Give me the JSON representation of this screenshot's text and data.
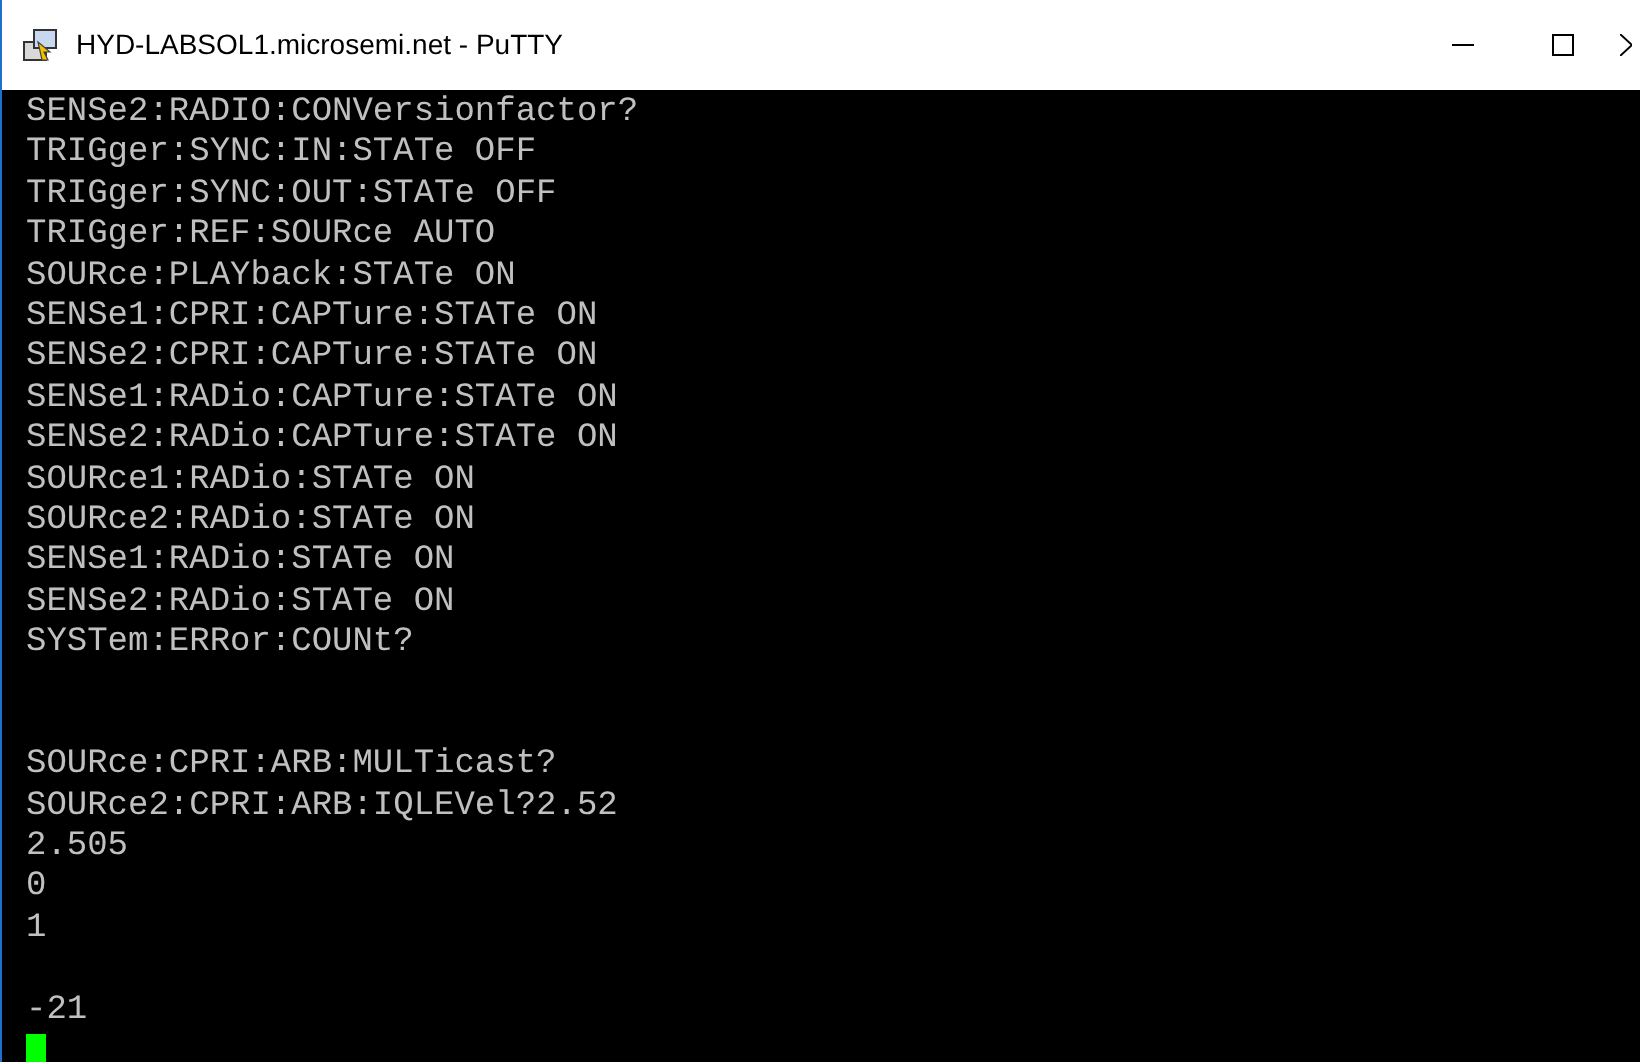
{
  "window": {
    "title": "HYD-LABSOL1.microsemi.net - PuTTY"
  },
  "terminal": {
    "lines": [
      {
        "kind": "text",
        "text": "SENSe2:RADIO:CONVersionfactor?"
      },
      {
        "kind": "text",
        "text": "TRIGger:SYNC:IN:STATe OFF"
      },
      {
        "kind": "text",
        "text": "TRIGger:SYNC:OUT:STATe OFF"
      },
      {
        "kind": "text",
        "text": "TRIGger:REF:SOURce AUTO"
      },
      {
        "kind": "text",
        "text": "SOURce:PLAYback:STATe ON"
      },
      {
        "kind": "text",
        "text": "SENSe1:CPRI:CAPTure:STATe ON"
      },
      {
        "kind": "text",
        "text": "SENSe2:CPRI:CAPTure:STATe ON"
      },
      {
        "kind": "text",
        "text": "SENSe1:RADio:CAPTure:STATe ON"
      },
      {
        "kind": "text",
        "text": "SENSe2:RADio:CAPTure:STATe ON"
      },
      {
        "kind": "text",
        "text": "SOURce1:RADio:STATe ON"
      },
      {
        "kind": "text",
        "text": "SOURce2:RADio:STATe ON"
      },
      {
        "kind": "text",
        "text": "SENSe1:RADio:STATe ON"
      },
      {
        "kind": "text",
        "text": "SENSe2:RADio:STATe ON"
      },
      {
        "kind": "text",
        "text": "SYSTem:ERRor:COUNt?"
      },
      {
        "kind": "gap"
      },
      {
        "kind": "gap"
      },
      {
        "kind": "text",
        "text": "SOURce:CPRI:ARB:MULTicast?"
      },
      {
        "kind": "text",
        "text": "SOURce2:CPRI:ARB:IQLEVel?2.52"
      },
      {
        "kind": "text",
        "text": "2.505"
      },
      {
        "kind": "text",
        "text": "0"
      },
      {
        "kind": "text",
        "text": "1"
      },
      {
        "kind": "gap"
      },
      {
        "kind": "text",
        "text": "-21"
      },
      {
        "kind": "cursor"
      }
    ]
  }
}
